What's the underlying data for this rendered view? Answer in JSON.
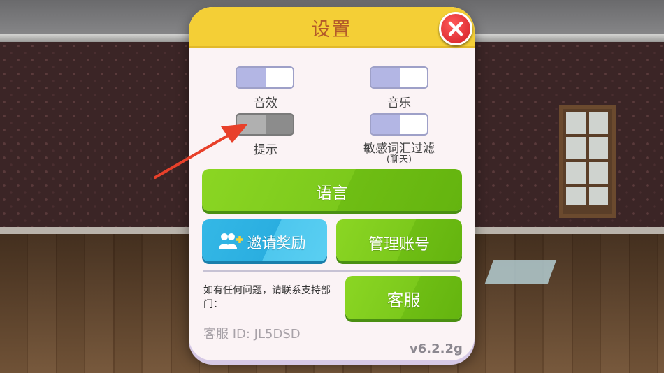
{
  "dialog": {
    "title": "设置",
    "close_icon": "close-icon"
  },
  "toggles": [
    {
      "label": "音效",
      "state": "on"
    },
    {
      "label": "音乐",
      "state": "on"
    },
    {
      "label": "提示",
      "state": "off"
    },
    {
      "label": "敏感词汇过滤",
      "sublabel": "(聊天)",
      "state": "on"
    }
  ],
  "buttons": {
    "language": "语言",
    "invite_reward": "邀请奖励",
    "invite_icon": "add-friends-icon",
    "manage_account": "管理账号",
    "customer_service": "客服"
  },
  "contact_text": "如有任何问题，请联系支持部门：",
  "customer_service_id": "客服 ID: JL5DSD",
  "version": "v6.2.2g",
  "colors": {
    "header": "#f4cf36",
    "title": "#b35a2a",
    "green_button": "#7cc91c",
    "blue_button": "#2aaee0",
    "toggle_on": "#b3b6e4",
    "close_button": "#d21f25",
    "arrow": "#e8402a"
  }
}
